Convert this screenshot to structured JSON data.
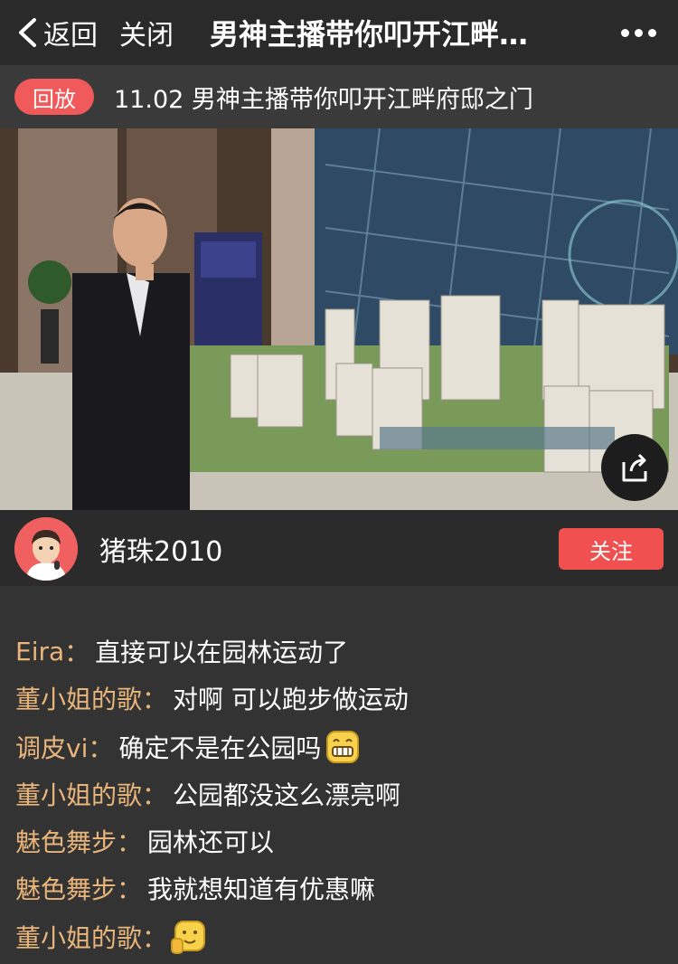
{
  "nav": {
    "back_label": "返回",
    "close_label": "关闭",
    "title": "男神主播带你叩开江畔…"
  },
  "replay": {
    "badge": "回放",
    "title": "11.02 男神主播带你叩开江畔府邸之门"
  },
  "host": {
    "name": "猪珠2010",
    "follow_label": "关注"
  },
  "chat": [
    {
      "user": "Eira",
      "sep": "：",
      "text": "直接可以在园林运动了",
      "emoji": ""
    },
    {
      "user": "董小姐的歌",
      "sep": "：",
      "text": "对啊 可以跑步做运动",
      "emoji": ""
    },
    {
      "user": "调皮vi",
      "sep": "：",
      "text": "确定不是在公园吗",
      "emoji": "grin-icon"
    },
    {
      "user": "董小姐的歌",
      "sep": "：",
      "text": "公园都没这么漂亮啊",
      "emoji": ""
    },
    {
      "user": "魅色舞步",
      "sep": "：",
      "text": "园林还可以",
      "emoji": ""
    },
    {
      "user": "魅色舞步",
      "sep": "：",
      "text": "我就想知道有优惠嘛",
      "emoji": ""
    },
    {
      "user": "董小姐的歌",
      "sep": "：",
      "text": "",
      "emoji": "thumbs-up-face-icon"
    }
  ],
  "colors": {
    "accent": "#f05050",
    "username": "#e9b57a",
    "background": "#333333"
  }
}
